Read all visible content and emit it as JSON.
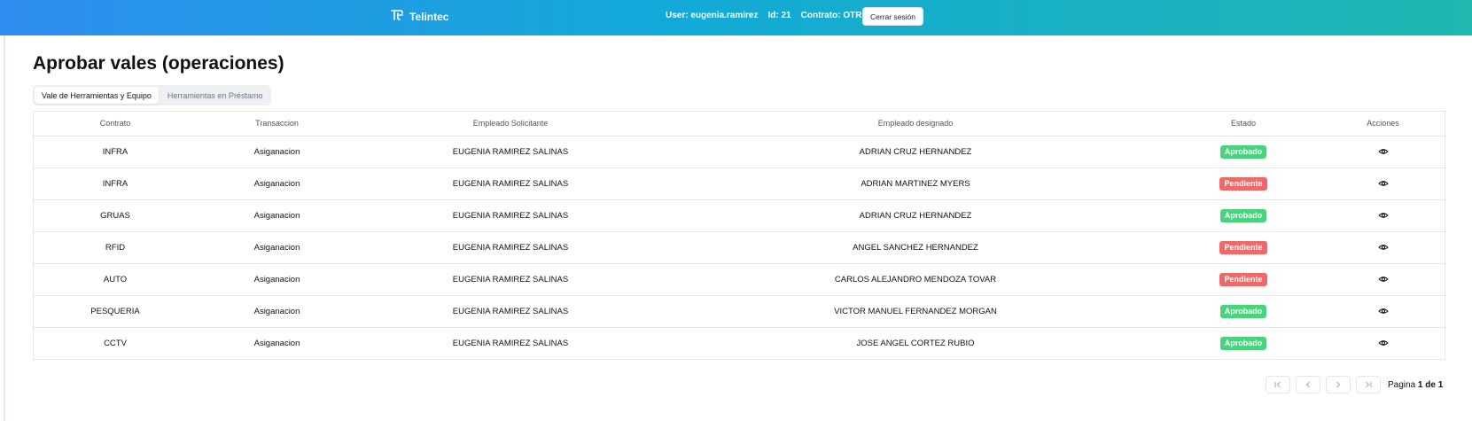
{
  "header": {
    "brand": "Telintec",
    "user_label": "User: eugenia.ramirez",
    "id_label": "Id: 21",
    "contract_label": "Contrato: OTROS",
    "logout_label": "Cerrar sesión"
  },
  "page": {
    "title": "Aprobar vales (operaciones)"
  },
  "tabs": [
    {
      "label": "Vale de Herramientas y Equipo",
      "active": true
    },
    {
      "label": "Herramientas en Préstamo",
      "active": false
    }
  ],
  "table": {
    "columns": [
      "Contrato",
      "Transaccion",
      "Empleado Solicitante",
      "Empleado designado",
      "Estado",
      "Acciones"
    ],
    "rows": [
      {
        "contrato": "INFRA",
        "transaccion": "Asiganacion",
        "solicitante": "EUGENIA RAMIREZ SALINAS",
        "designado": "ADRIAN CRUZ HERNANDEZ",
        "estado": "Aprobado"
      },
      {
        "contrato": "INFRA",
        "transaccion": "Asiganacion",
        "solicitante": "EUGENIA RAMIREZ SALINAS",
        "designado": "ADRIAN MARTINEZ MYERS",
        "estado": "Pendiente"
      },
      {
        "contrato": "GRUAS",
        "transaccion": "Asiganacion",
        "solicitante": "EUGENIA RAMIREZ SALINAS",
        "designado": "ADRIAN CRUZ HERNANDEZ",
        "estado": "Aprobado"
      },
      {
        "contrato": "RFID",
        "transaccion": "Asiganacion",
        "solicitante": "EUGENIA RAMIREZ SALINAS",
        "designado": "ANGEL SANCHEZ HERNANDEZ",
        "estado": "Pendiente"
      },
      {
        "contrato": "AUTO",
        "transaccion": "Asiganacion",
        "solicitante": "EUGENIA RAMIREZ SALINAS",
        "designado": "CARLOS ALEJANDRO MENDOZA TOVAR",
        "estado": "Pendiente"
      },
      {
        "contrato": "PESQUERIA",
        "transaccion": "Asiganacion",
        "solicitante": "EUGENIA RAMIREZ SALINAS",
        "designado": "VICTOR MANUEL FERNANDEZ MORGAN",
        "estado": "Aprobado"
      },
      {
        "contrato": "CCTV",
        "transaccion": "Asiganacion",
        "solicitante": "EUGENIA RAMIREZ SALINAS",
        "designado": "JOSE ANGEL CORTEZ RUBIO",
        "estado": "Aprobado"
      }
    ]
  },
  "pagination": {
    "prefix": "Pagina",
    "current": "1",
    "separator": "de",
    "total": "1"
  },
  "colors": {
    "approved": "#4ad37d",
    "pending": "#ee6a6a",
    "header_start": "#2f8ef0",
    "header_end": "#1fb7b0"
  },
  "icons": {
    "brand": "telintec-logo-icon",
    "action": "eye-icon"
  }
}
